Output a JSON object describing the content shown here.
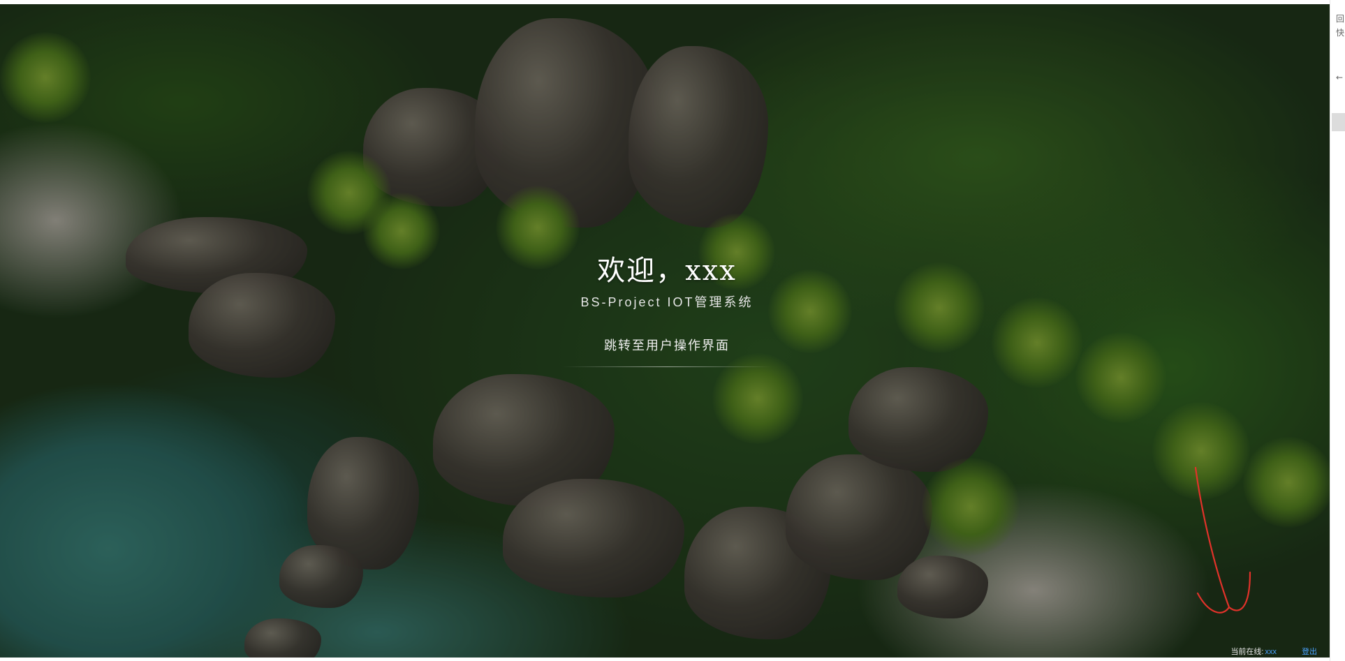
{
  "welcome": {
    "title": "欢迎，xxx",
    "subtitle": "BS-Project IOT管理系统",
    "jump_link": "跳转至用户操作界面"
  },
  "footer": {
    "online_label": "当前在线:",
    "online_value": "xxx",
    "logout": "登出"
  },
  "side_strip": {
    "top_glyph_1": "回",
    "top_glyph_2": "快",
    "back_glyph": "←"
  },
  "colors": {
    "accent_link": "#4aa3ff",
    "annotation": "#e2322a"
  }
}
